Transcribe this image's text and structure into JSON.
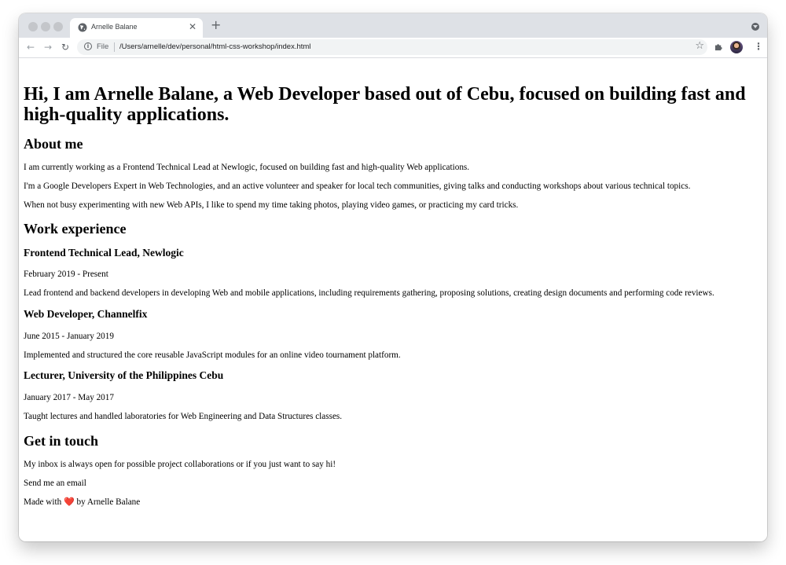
{
  "browser": {
    "tab_title": "Arnelle Balane",
    "new_tab_symbol": "+",
    "close_symbol": "✕",
    "scheme_label": "File",
    "url": "/Users/arnelle/dev/personal/html-css-workshop/index.html",
    "nav": {
      "back": "←",
      "forward": "→",
      "reload": "↻"
    },
    "bookmark_symbol": "☆",
    "menu_symbol": "⋮"
  },
  "page": {
    "heading": "Hi, I am Arnelle Balane, a Web Developer based out of Cebu, focused on building fast and high-quality applications.",
    "about": {
      "title": "About me",
      "paragraphs": [
        "I am currently working as a Frontend Technical Lead at Newlogic, focused on building fast and high-quality Web applications.",
        "I'm a Google Developers Expert in Web Technologies, and an active volunteer and speaker for local tech communities, giving talks and conducting workshops about various technical topics.",
        "When not busy experimenting with new Web APIs, I like to spend my time taking photos, playing video games, or practicing my card tricks."
      ]
    },
    "work": {
      "title": "Work experience",
      "jobs": [
        {
          "title": "Frontend Technical Lead, Newlogic",
          "period": "February 2019 - Present",
          "description": "Lead frontend and backend developers in developing Web and mobile applications, including requirements gathering, proposing solutions, creating design documents and performing code reviews."
        },
        {
          "title": "Web Developer, Channelfix",
          "period": "June 2015 - January 2019",
          "description": "Implemented and structured the core reusable JavaScript modules for an online video tournament platform."
        },
        {
          "title": "Lecturer, University of the Philippines Cebu",
          "period": "January 2017 - May 2017",
          "description": "Taught lectures and handled laboratories for Web Engineering and Data Structures classes."
        }
      ]
    },
    "contact": {
      "title": "Get in touch",
      "text": "My inbox is always open for possible project collaborations or if you just want to say hi!",
      "link": "Send me an email"
    },
    "footer": {
      "prefix": "Made with",
      "heart": "❤️",
      "suffix": "by Arnelle Balane"
    }
  }
}
